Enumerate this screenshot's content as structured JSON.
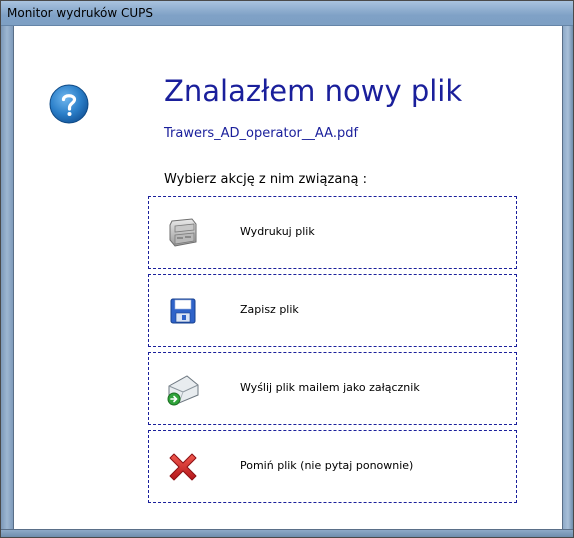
{
  "window": {
    "title": "Monitor wydruków CUPS"
  },
  "dialog": {
    "icon": "help-question-icon",
    "heading": "Znalazłem nowy plik",
    "file_name": "Trawers_AD_operator__AA.pdf",
    "prompt": "Wybierz akcję z nim związaną :"
  },
  "actions": [
    {
      "label": "Wydrukuj plik",
      "icon": "printer-icon"
    },
    {
      "label": "Zapisz plik",
      "icon": "floppy-disk-icon"
    },
    {
      "label": "Wyślij plik mailem jako załącznik",
      "icon": "email-attach-icon"
    },
    {
      "label": "Pomiń plik (nie pytaj ponownie)",
      "icon": "red-x-icon"
    }
  ],
  "colors": {
    "accent": "#1a1f9b",
    "help_icon": "#1f6fb5",
    "skip_icon": "#d8262a"
  }
}
